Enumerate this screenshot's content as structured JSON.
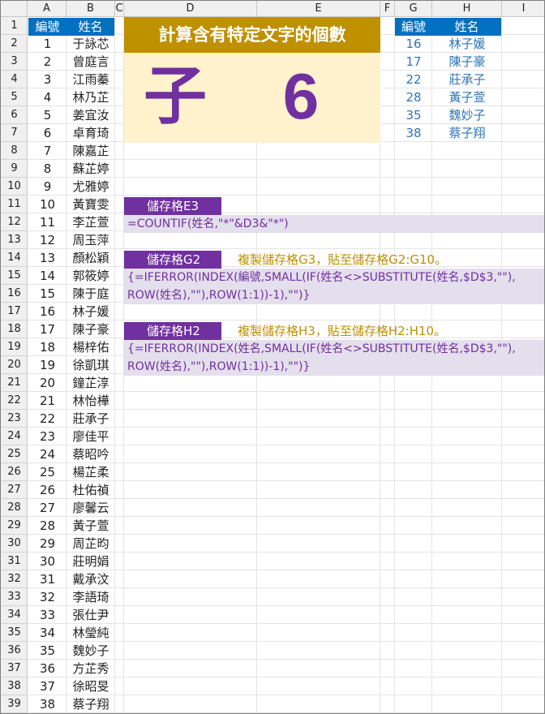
{
  "columns": [
    "A",
    "B",
    "C",
    "D",
    "E",
    "F",
    "G",
    "H",
    "I"
  ],
  "rows": [
    "1",
    "2",
    "3",
    "4",
    "5",
    "6",
    "7",
    "8",
    "9",
    "10",
    "11",
    "12",
    "13",
    "14",
    "15",
    "16",
    "17",
    "18",
    "19",
    "20",
    "21",
    "22",
    "23",
    "24",
    "25",
    "26",
    "27",
    "28",
    "29",
    "30",
    "31",
    "32",
    "33",
    "34",
    "35",
    "36",
    "37",
    "38",
    "39"
  ],
  "list": {
    "header_id": "編號",
    "header_name": "姓名",
    "ids": [
      "1",
      "2",
      "3",
      "4",
      "5",
      "6",
      "7",
      "8",
      "9",
      "10",
      "11",
      "12",
      "13",
      "14",
      "15",
      "16",
      "17",
      "18",
      "19",
      "20",
      "21",
      "22",
      "23",
      "24",
      "25",
      "26",
      "27",
      "28",
      "29",
      "30",
      "31",
      "32",
      "33",
      "34",
      "35",
      "36",
      "37",
      "38"
    ],
    "names": [
      "于詠芯",
      "曾庭言",
      "江雨蓁",
      "林乃芷",
      "姜宜汝",
      "卓育琦",
      "陳嘉芷",
      "蘇芷婷",
      "尤雅婷",
      "黃寶雯",
      "李芷萱",
      "周玉萍",
      "顏松穎",
      "郭筱婷",
      "陳于庭",
      "林子媛",
      "陳子豪",
      "楊梓佑",
      "徐凱琪",
      "鐘芷淳",
      "林怡樺",
      "莊承子",
      "廖佳平",
      "蔡昭吟",
      "楊芷柔",
      "杜佑禎",
      "廖馨云",
      "黃子萱",
      "周芷昀",
      "莊明娟",
      "戴承汶",
      "李語琦",
      "張仕尹",
      "林瑩純",
      "魏妙子",
      "方芷秀",
      "徐昭旻",
      "蔡子翔"
    ]
  },
  "panel": {
    "title": "計算含有特定文字的個數",
    "search_char": "子",
    "count": "6"
  },
  "results": {
    "header_id": "編號",
    "header_name": "姓名",
    "ids": [
      "16",
      "17",
      "22",
      "28",
      "35",
      "38"
    ],
    "names": [
      "林子媛",
      "陳子豪",
      "莊承子",
      "黃子萱",
      "魏妙子",
      "蔡子翔"
    ]
  },
  "formulas": {
    "e3_label": "儲存格E3",
    "e3_formula": "=COUNTIF(姓名,\"*\"&D3&\"*\")",
    "g2_label": "儲存格G2",
    "g2_note": "複製儲存格G3，貼至儲存格G2:G10。",
    "g2_line1": "{=IFERROR(INDEX(編號,SMALL(IF(姓名<>SUBSTITUTE(姓名,$D$3,\"\"),",
    "g2_line2": "ROW(姓名),\"\"),ROW(1:1))-1),\"\")}",
    "h2_label": "儲存格H2",
    "h2_note": "複製儲存格H3，貼至儲存格H2:H10。",
    "h2_line1": "{=IFERROR(INDEX(姓名,SMALL(IF(姓名<>SUBSTITUTE(姓名,$D$3,\"\"),",
    "h2_line2": "ROW(姓名),\"\"),ROW(1:1))-1),\"\")}"
  },
  "colors": {
    "header_blue": "#0070c0",
    "gold": "#bf9000",
    "light_gold": "#fff2cc",
    "purple": "#7030a0",
    "light_purple": "#e4dfec",
    "result_blue": "#2e75b6"
  }
}
